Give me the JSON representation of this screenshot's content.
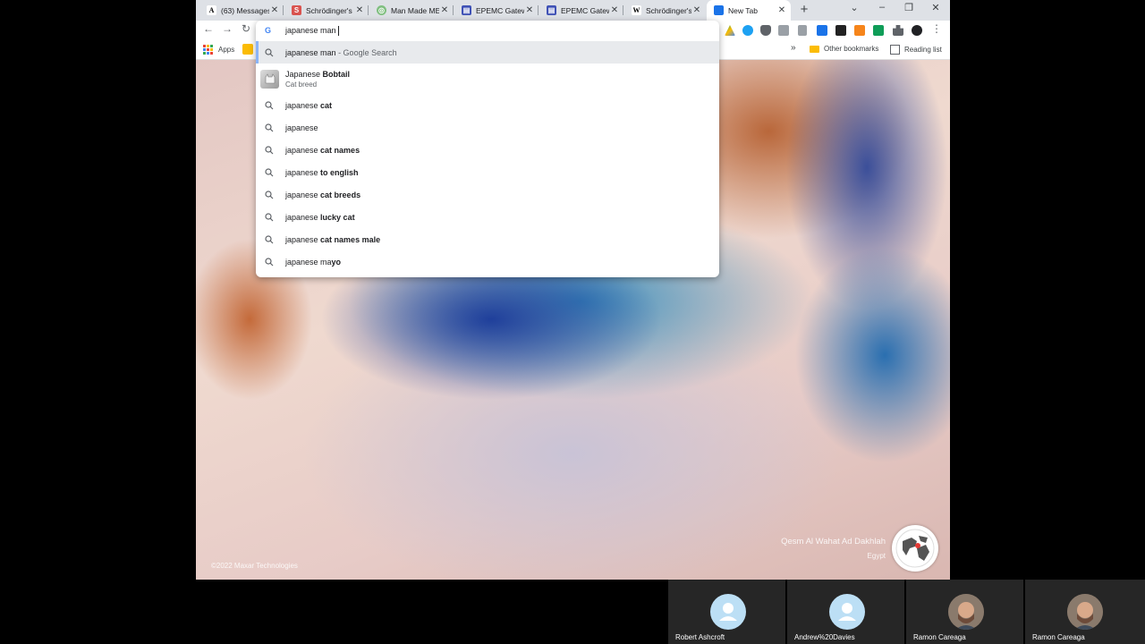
{
  "tabs": [
    {
      "title": "(63) Messages",
      "icon": "A-icon",
      "color": "#ffffff"
    },
    {
      "title": "Schrödinger's",
      "icon": "stackexchange-icon",
      "color": "#d9534f"
    },
    {
      "title": "Man Made ME",
      "icon": "spiral-icon",
      "color": "#7fbf7f"
    },
    {
      "title": "EPEMC Gatewa",
      "icon": "table-icon",
      "color": "#3f51b5"
    },
    {
      "title": "EPEMC Gatewa",
      "icon": "table-icon",
      "color": "#3f51b5"
    },
    {
      "title": "Schrödinger's",
      "icon": "W-icon",
      "color": "#ffffff"
    },
    {
      "title": "New Tab",
      "icon": "newtab-icon",
      "color": "#1a73e8"
    }
  ],
  "bookmarks": {
    "apps": "Apps",
    "overflow": "»",
    "other": "Other bookmarks",
    "reading": "Reading list"
  },
  "omnibox": {
    "query": "japanese man",
    "first": {
      "text": "japanese man",
      "note": "- Google Search"
    },
    "entity": {
      "prefix": "Japanese ",
      "bold": "Bobtail",
      "sub": "Cat breed"
    },
    "suggestions": [
      {
        "prefix": "japanese ",
        "bold": "cat"
      },
      {
        "prefix": "japanese",
        "bold": ""
      },
      {
        "prefix": "japanese ",
        "bold": "cat names"
      },
      {
        "prefix": "japanese ",
        "bold": "to english"
      },
      {
        "prefix": "japanese ",
        "bold": "cat breeds"
      },
      {
        "prefix": "japanese ",
        "bold": "lucky cat"
      },
      {
        "prefix": "japanese ",
        "bold": "cat names male"
      },
      {
        "prefix": "japanese ma",
        "bold": "yo"
      }
    ]
  },
  "wallpaper": {
    "location": "Qesm Al Wahat Ad Dakhlah",
    "country": "Egypt",
    "credit": "©2022 Maxar Technologies"
  },
  "participants": [
    {
      "name": "Robert Ashcroft"
    },
    {
      "name": "Andrew%20Davies"
    },
    {
      "name": "Ramon Careaga"
    },
    {
      "name": "Ramon Careaga"
    }
  ]
}
